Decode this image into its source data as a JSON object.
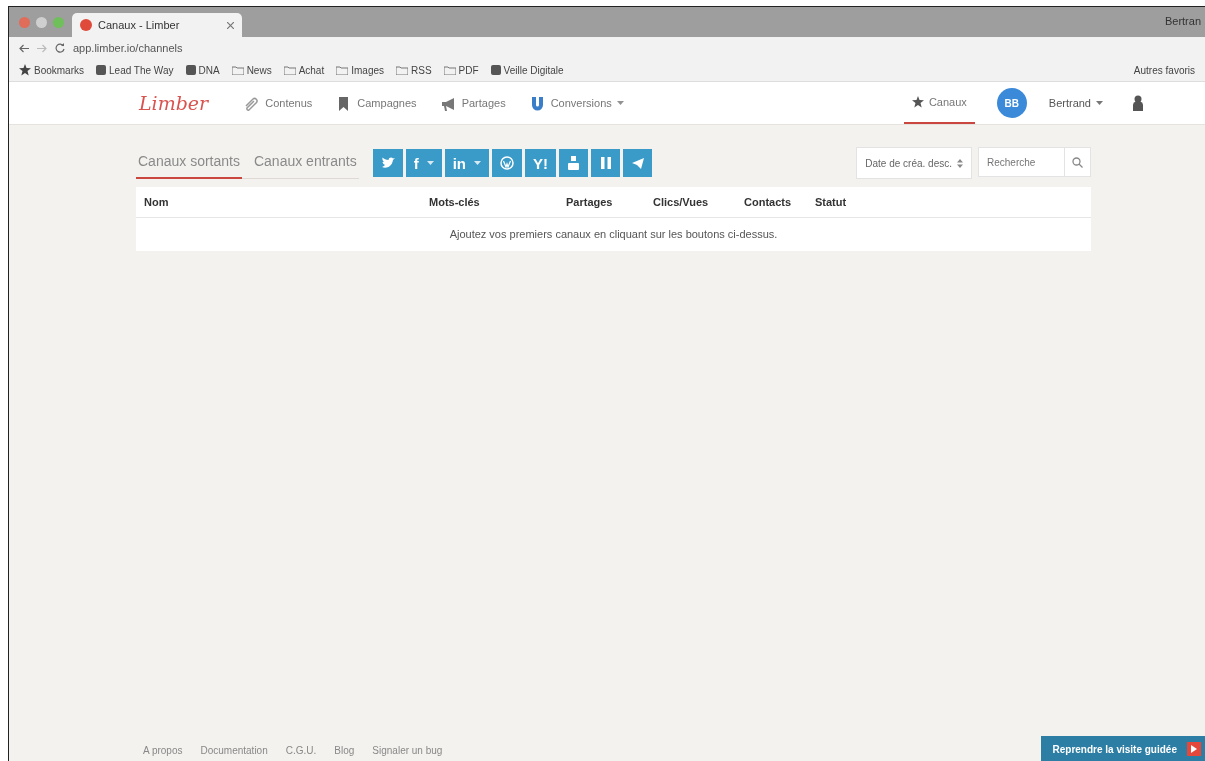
{
  "browser": {
    "tab_title": "Canaux - Limber",
    "url": "app.limber.io/channels",
    "profile": "Bertran",
    "bookmarks": [
      {
        "label": "Bookmarks",
        "kind": "star"
      },
      {
        "label": "Lead The Way",
        "kind": "site"
      },
      {
        "label": "DNA",
        "kind": "site"
      },
      {
        "label": "News",
        "kind": "folder"
      },
      {
        "label": "Achat",
        "kind": "folder"
      },
      {
        "label": "Images",
        "kind": "folder"
      },
      {
        "label": "RSS",
        "kind": "folder"
      },
      {
        "label": "PDF",
        "kind": "folder"
      },
      {
        "label": "Veille Digitale",
        "kind": "site"
      }
    ],
    "other_bookmarks": "Autres favoris"
  },
  "app": {
    "logo": "Limber",
    "nav": [
      {
        "label": "Contenus",
        "kind": "clip",
        "dropdown": false
      },
      {
        "label": "Campagnes",
        "kind": "bookmark",
        "dropdown": false
      },
      {
        "label": "Partages",
        "kind": "megaphone",
        "dropdown": false
      },
      {
        "label": "Conversions",
        "kind": "magnet",
        "dropdown": true
      }
    ],
    "channels_link": {
      "label": "Canaux",
      "selected": true
    },
    "avatar": "BB",
    "user": "Bertrand"
  },
  "tabs": [
    {
      "label": "Canaux sortants",
      "selected": true
    },
    {
      "label": "Canaux entrants",
      "selected": false
    }
  ],
  "add_buttons": [
    {
      "kind": "twitter",
      "dropdown": false
    },
    {
      "kind": "text",
      "label": "f",
      "dropdown": true
    },
    {
      "kind": "text",
      "label": "in",
      "dropdown": true
    },
    {
      "kind": "wordpress",
      "dropdown": false
    },
    {
      "kind": "text",
      "label": "Y!",
      "dropdown": false
    },
    {
      "kind": "youtube",
      "dropdown": false
    },
    {
      "kind": "pause",
      "dropdown": false
    },
    {
      "kind": "telegram",
      "dropdown": false
    }
  ],
  "sort": {
    "value": "Date de créa. desc."
  },
  "search": {
    "placeholder": "Recherche"
  },
  "table": {
    "columns": [
      "Nom",
      "Mots-clés",
      "Partages",
      "Clics/Vues",
      "Contacts",
      "Statut"
    ],
    "empty_message": "Ajoutez vos premiers canaux en cliquant sur les boutons ci-dessus."
  },
  "footer": {
    "links": [
      "A propos",
      "Documentation",
      "C.G.U.",
      "Blog",
      "Signaler un bug"
    ]
  },
  "tour_button": "Reprendre la visite guidée"
}
